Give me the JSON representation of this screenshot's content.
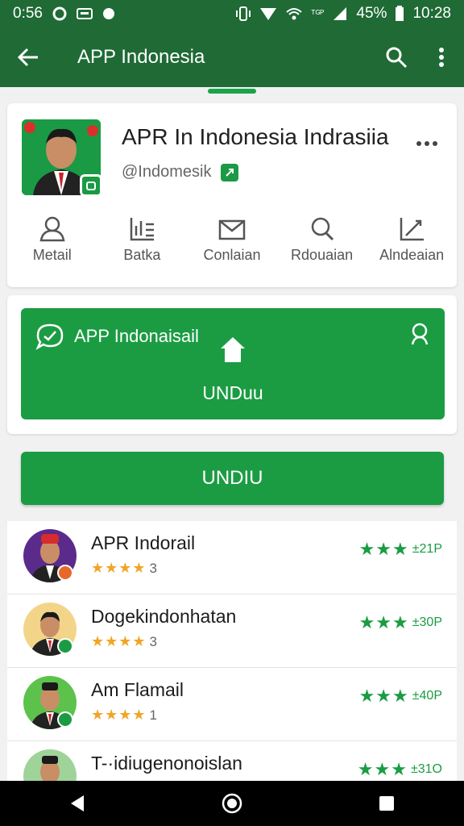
{
  "status_bar": {
    "time_left": "0:56",
    "battery_pct": "45%",
    "clock": "10:28",
    "net_label": "ᵀᴳᴾ"
  },
  "app_bar": {
    "title": "APP Indonesia"
  },
  "profile": {
    "name": "APR In Indonesia Indrasiia",
    "handle": "@Indomesik",
    "actions": [
      {
        "label": "Metail",
        "icon": "user-icon"
      },
      {
        "label": "Batka",
        "icon": "chart-icon"
      },
      {
        "label": "Conlaian",
        "icon": "mail-icon"
      },
      {
        "label": "Rdouaian",
        "icon": "search-icon"
      },
      {
        "label": "Alndeaian",
        "icon": "edit-icon"
      }
    ]
  },
  "promo": {
    "title": "APP Indonaisail",
    "button_label": "UNDuu"
  },
  "primary_button": {
    "label": "UNDIU"
  },
  "list": [
    {
      "name": "APR Indorail",
      "stars": "★★★★",
      "count": "3",
      "rating": "★★★",
      "num": "±21P",
      "avatar_bg": "#5b2b8c",
      "badge_color": "#e8672a"
    },
    {
      "name": "Dogekindonhatan",
      "stars": "★★★★",
      "count": "3",
      "rating": "★★★",
      "num": "±30P",
      "avatar_bg": "#f3d58a",
      "badge_color": "#1b9c43"
    },
    {
      "name": "Am Flamail",
      "stars": "★★★★",
      "count": "1",
      "rating": "★★★",
      "num": "±40P",
      "avatar_bg": "#5cc24c",
      "badge_color": "#1b9c43"
    },
    {
      "name": "T-·idiugenonoislan",
      "stars": "★★★★",
      "count": "",
      "rating": "★★★",
      "num": "±31O",
      "avatar_bg": "#9fd39a",
      "badge_color": "#1b9c43"
    }
  ],
  "colors": {
    "app_bar": "#1f6a35",
    "accent": "#1b9c43",
    "star": "#f0a526"
  }
}
